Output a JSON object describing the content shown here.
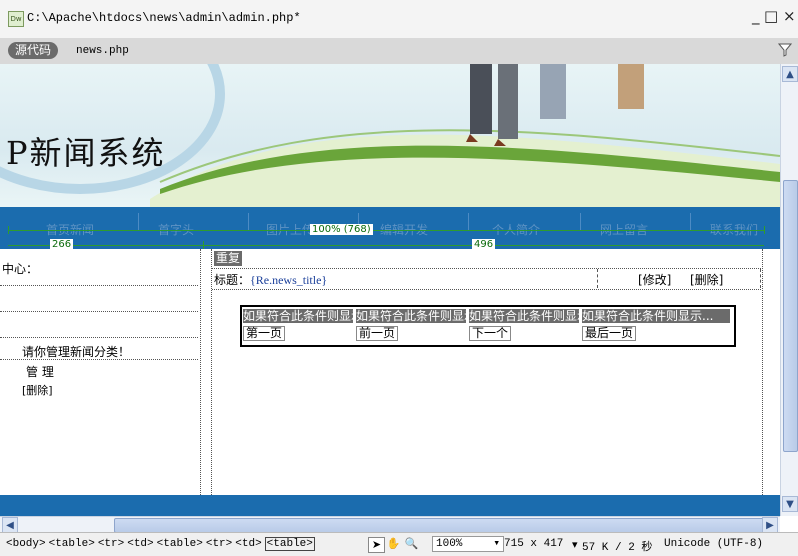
{
  "window": {
    "app_icon_label": "Dw",
    "file_path": "C:\\Apache\\htdocs\\news\\admin\\admin.php*",
    "minimize_glyph": "_",
    "close_glyph": "□ ×"
  },
  "doc_toolbar": {
    "source_code_label": "源代码",
    "file_name": "news.php"
  },
  "banner": {
    "title": "P新闻系统"
  },
  "navbar": {
    "items": [
      "首页新闻",
      "首字头",
      "图片上传",
      "编辑开发",
      "个人简介",
      "网上留言",
      "联系我们"
    ]
  },
  "rulers": {
    "top_label": "100% (768)",
    "left_label": "266",
    "right_label": "496"
  },
  "left_column": {
    "heading": "中心：",
    "prompt": "请你管理新闻分类！",
    "manage": "管  理",
    "delete": "[删除]"
  },
  "right_column": {
    "repeat_label": "重复",
    "title_label": "标题：",
    "title_field": "{Re.news_title}",
    "edit_link": "[修改]",
    "delete_link": "[删除]"
  },
  "pager": {
    "condition_texts": [
      "如果符合此条件则显示",
      "如果符合此条件则显示",
      "如果符合此条件则显示",
      "如果符合此条件则显示..."
    ],
    "links": [
      "第一页",
      "前一页",
      "下一个",
      "最后一页"
    ]
  },
  "statusbar": {
    "tags": [
      "<body>",
      "<table>",
      "<tr>",
      "<td>",
      "<table>",
      "<tr>",
      "<td>",
      "<table>"
    ],
    "zoom": "100%",
    "window_size": "715 x 417",
    "file_info": "57 K / 2 秒",
    "encoding": "Unicode (UTF-8)"
  },
  "colors": {
    "nav_blue": "#1b6cae",
    "ruler_green": "#2e9c2e",
    "template_gray": "#6b6b6b"
  }
}
